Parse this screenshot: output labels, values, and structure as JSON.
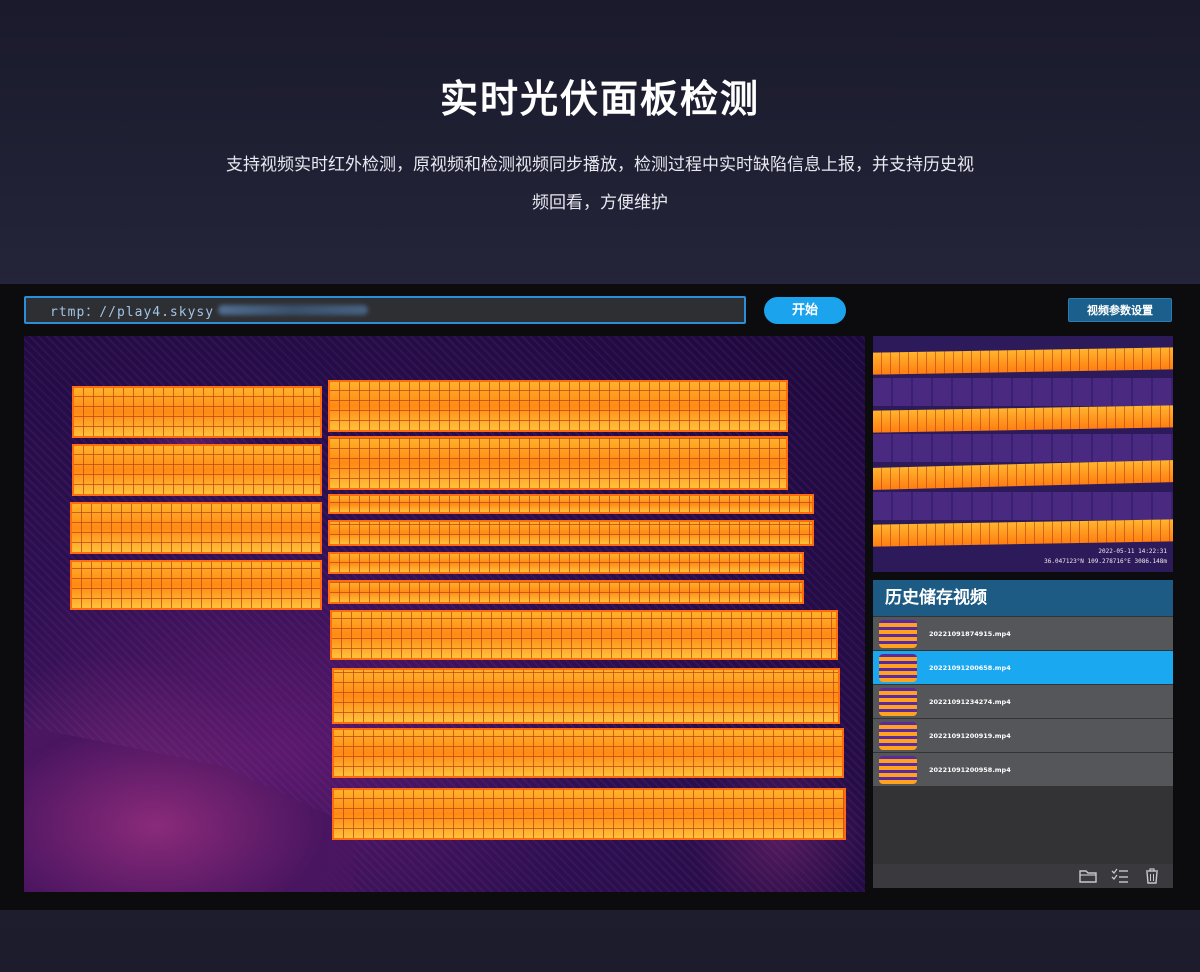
{
  "hero": {
    "title": "实时光伏面板检测",
    "desc_line1": "支持视频实时红外检测，原视频和检测视频同步播放，检测过程中实时缺陷信息上报，并支持历史视",
    "desc_line2": "频回看，方便维护"
  },
  "toolbar": {
    "url_value": "rtmp：//play4.skysy",
    "start_label": "开始",
    "params_label": "视频参数设置"
  },
  "preview": {
    "timestamp": "2022-05-11 14:22:31",
    "coords": "36.047123°N 109.278716°E 3086.148m"
  },
  "history": {
    "title": "历史储存视频",
    "items": [
      {
        "name": "20221091874915.mp4"
      },
      {
        "name": "20221091200658.mp4"
      },
      {
        "name": "20221091234274.mp4"
      },
      {
        "name": "20221091200919.mp4"
      },
      {
        "name": "20221091200958.mp4"
      }
    ],
    "active_index": 1
  },
  "icons": [
    "folder-icon",
    "checklist-icon",
    "trash-icon"
  ],
  "colors": {
    "accent": "#1ca3ee",
    "header": "#1d5a84",
    "thermal_hot": "#ffb22a",
    "thermal_cold": "#2a1050"
  }
}
